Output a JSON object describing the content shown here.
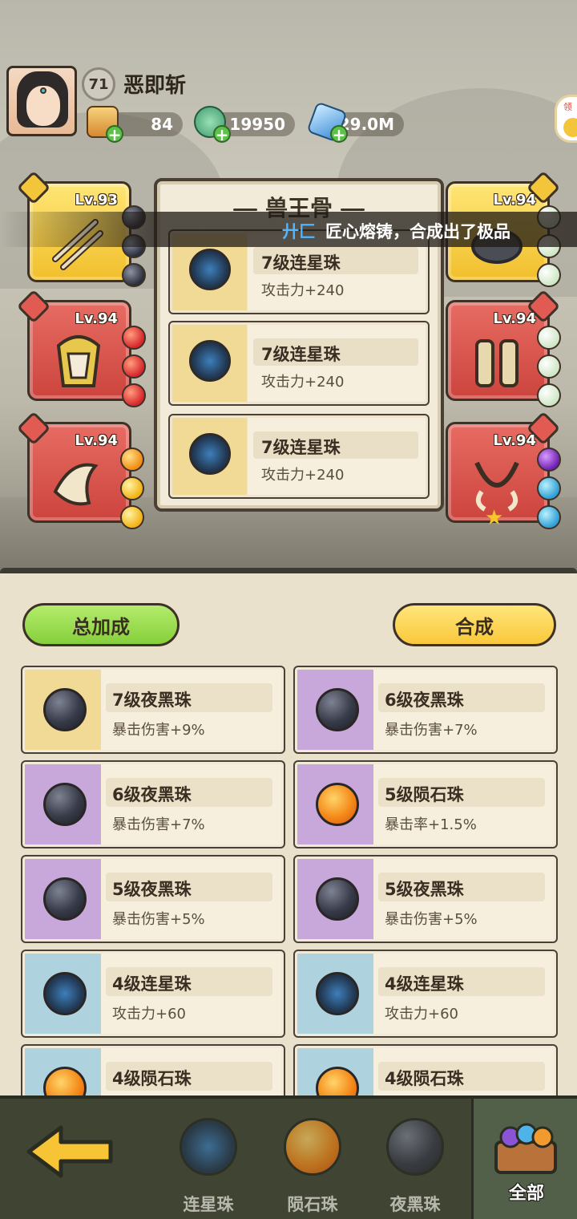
{
  "player": {
    "level": "71",
    "name": "恶即斩"
  },
  "resources": [
    {
      "icon": "scroll-ticket-icon",
      "value": "84"
    },
    {
      "icon": "jade-dragon-icon",
      "value": "19950"
    },
    {
      "icon": "blue-crystal-icon",
      "value": "129.0M"
    }
  ],
  "side_button": {
    "label": "领"
  },
  "equipment_left": [
    {
      "level": "Lv.93",
      "rarity": "gold",
      "gems": [
        "dark",
        "dark",
        "dark"
      ]
    },
    {
      "level": "Lv.94",
      "rarity": "red",
      "gems": [
        "red",
        "red",
        "red"
      ]
    },
    {
      "level": "Lv.94",
      "rarity": "red",
      "gems": [
        "orange",
        "gold",
        "gold"
      ]
    }
  ],
  "equipment_right": [
    {
      "level": "Lv.94",
      "rarity": "gold",
      "gems": [
        "pale",
        "pale",
        "pale"
      ]
    },
    {
      "level": "Lv.94",
      "rarity": "red",
      "gems": [
        "pale",
        "pale",
        "pale"
      ]
    },
    {
      "level": "Lv.94",
      "rarity": "red",
      "gems": [
        "purple",
        "blue",
        "blue"
      ]
    }
  ],
  "popup": {
    "title": "兽王骨",
    "items": [
      {
        "name": "7级连星珠",
        "stat": "攻击力+240"
      },
      {
        "name": "7级连星珠",
        "stat": "攻击力+240"
      },
      {
        "name": "7级连星珠",
        "stat": "攻击力+240"
      }
    ]
  },
  "marquee": {
    "player": "廾匚",
    "message": "匠心熔铸，合成出了极品"
  },
  "buttons": {
    "total_bonus": "总加成",
    "combine": "合成"
  },
  "gem_cards": [
    {
      "name": "7级夜黑珠",
      "stat": "暴击伤害+9%",
      "bg": "gold",
      "orb": "dark"
    },
    {
      "name": "6级夜黑珠",
      "stat": "暴击伤害+7%",
      "bg": "purple",
      "orb": "dark"
    },
    {
      "name": "6级夜黑珠",
      "stat": "暴击伤害+7%",
      "bg": "purple",
      "orb": "dark"
    },
    {
      "name": "5级陨石珠",
      "stat": "暴击率+1.5%",
      "bg": "purple",
      "orb": "fire"
    },
    {
      "name": "5级夜黑珠",
      "stat": "暴击伤害+5%",
      "bg": "purple",
      "orb": "dark"
    },
    {
      "name": "5级夜黑珠",
      "stat": "暴击伤害+5%",
      "bg": "purple",
      "orb": "dark"
    },
    {
      "name": "4级连星珠",
      "stat": "攻击力+60",
      "bg": "blue",
      "orb": "star"
    },
    {
      "name": "4级连星珠",
      "stat": "攻击力+60",
      "bg": "blue",
      "orb": "star"
    },
    {
      "name": "4级陨石珠",
      "stat": "",
      "bg": "blue",
      "orb": "fire"
    },
    {
      "name": "4级陨石珠",
      "stat": "",
      "bg": "blue",
      "orb": "fire"
    }
  ],
  "bottom_tabs": [
    {
      "label": "连星珠",
      "orb": "star"
    },
    {
      "label": "陨石珠",
      "orb": "fire"
    },
    {
      "label": "夜黑珠",
      "orb": "dark"
    },
    {
      "label": "全部",
      "orb": "chest"
    }
  ]
}
